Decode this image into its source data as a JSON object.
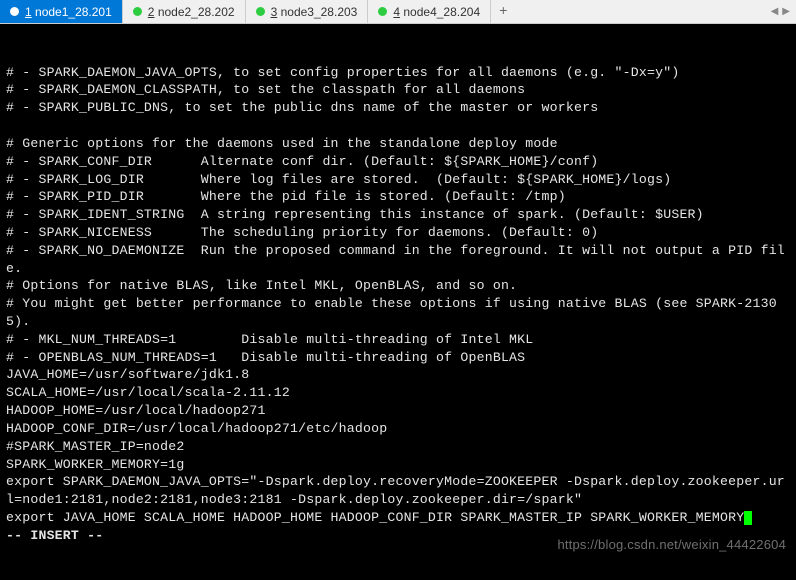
{
  "tabs": [
    {
      "num": "1",
      "label": "node1_28.201",
      "active": true
    },
    {
      "num": "2",
      "label": "node2_28.202",
      "active": false
    },
    {
      "num": "3",
      "label": "node3_28.203",
      "active": false
    },
    {
      "num": "4",
      "label": "node4_28.204",
      "active": false
    }
  ],
  "add_tab": "+",
  "nav_left": "◀",
  "nav_right": "▶",
  "terminal_lines": [
    "# - SPARK_DAEMON_JAVA_OPTS, to set config properties for all daemons (e.g. \"-Dx=y\")",
    "# - SPARK_DAEMON_CLASSPATH, to set the classpath for all daemons",
    "# - SPARK_PUBLIC_DNS, to set the public dns name of the master or workers",
    "",
    "# Generic options for the daemons used in the standalone deploy mode",
    "# - SPARK_CONF_DIR      Alternate conf dir. (Default: ${SPARK_HOME}/conf)",
    "# - SPARK_LOG_DIR       Where log files are stored.  (Default: ${SPARK_HOME}/logs)",
    "# - SPARK_PID_DIR       Where the pid file is stored. (Default: /tmp)",
    "# - SPARK_IDENT_STRING  A string representing this instance of spark. (Default: $USER)",
    "# - SPARK_NICENESS      The scheduling priority for daemons. (Default: 0)",
    "# - SPARK_NO_DAEMONIZE  Run the proposed command in the foreground. It will not output a PID file.",
    "# Options for native BLAS, like Intel MKL, OpenBLAS, and so on.",
    "# You might get better performance to enable these options if using native BLAS (see SPARK-21305).",
    "# - MKL_NUM_THREADS=1        Disable multi-threading of Intel MKL",
    "# - OPENBLAS_NUM_THREADS=1   Disable multi-threading of OpenBLAS",
    "JAVA_HOME=/usr/software/jdk1.8",
    "SCALA_HOME=/usr/local/scala-2.11.12",
    "HADOOP_HOME=/usr/local/hadoop271",
    "HADOOP_CONF_DIR=/usr/local/hadoop271/etc/hadoop",
    "#SPARK_MASTER_IP=node2",
    "SPARK_WORKER_MEMORY=1g",
    "export SPARK_DAEMON_JAVA_OPTS=\"-Dspark.deploy.recoveryMode=ZOOKEEPER -Dspark.deploy.zookeeper.url=node1:2181,node2:2181,node3:2181 -Dspark.deploy.zookeeper.dir=/spark\"",
    "export JAVA_HOME SCALA_HOME HADOOP_HOME HADOOP_CONF_DIR SPARK_MASTER_IP SPARK_WORKER_MEMORY"
  ],
  "status_line": "-- INSERT --",
  "watermark": "https://blog.csdn.net/weixin_44422604"
}
